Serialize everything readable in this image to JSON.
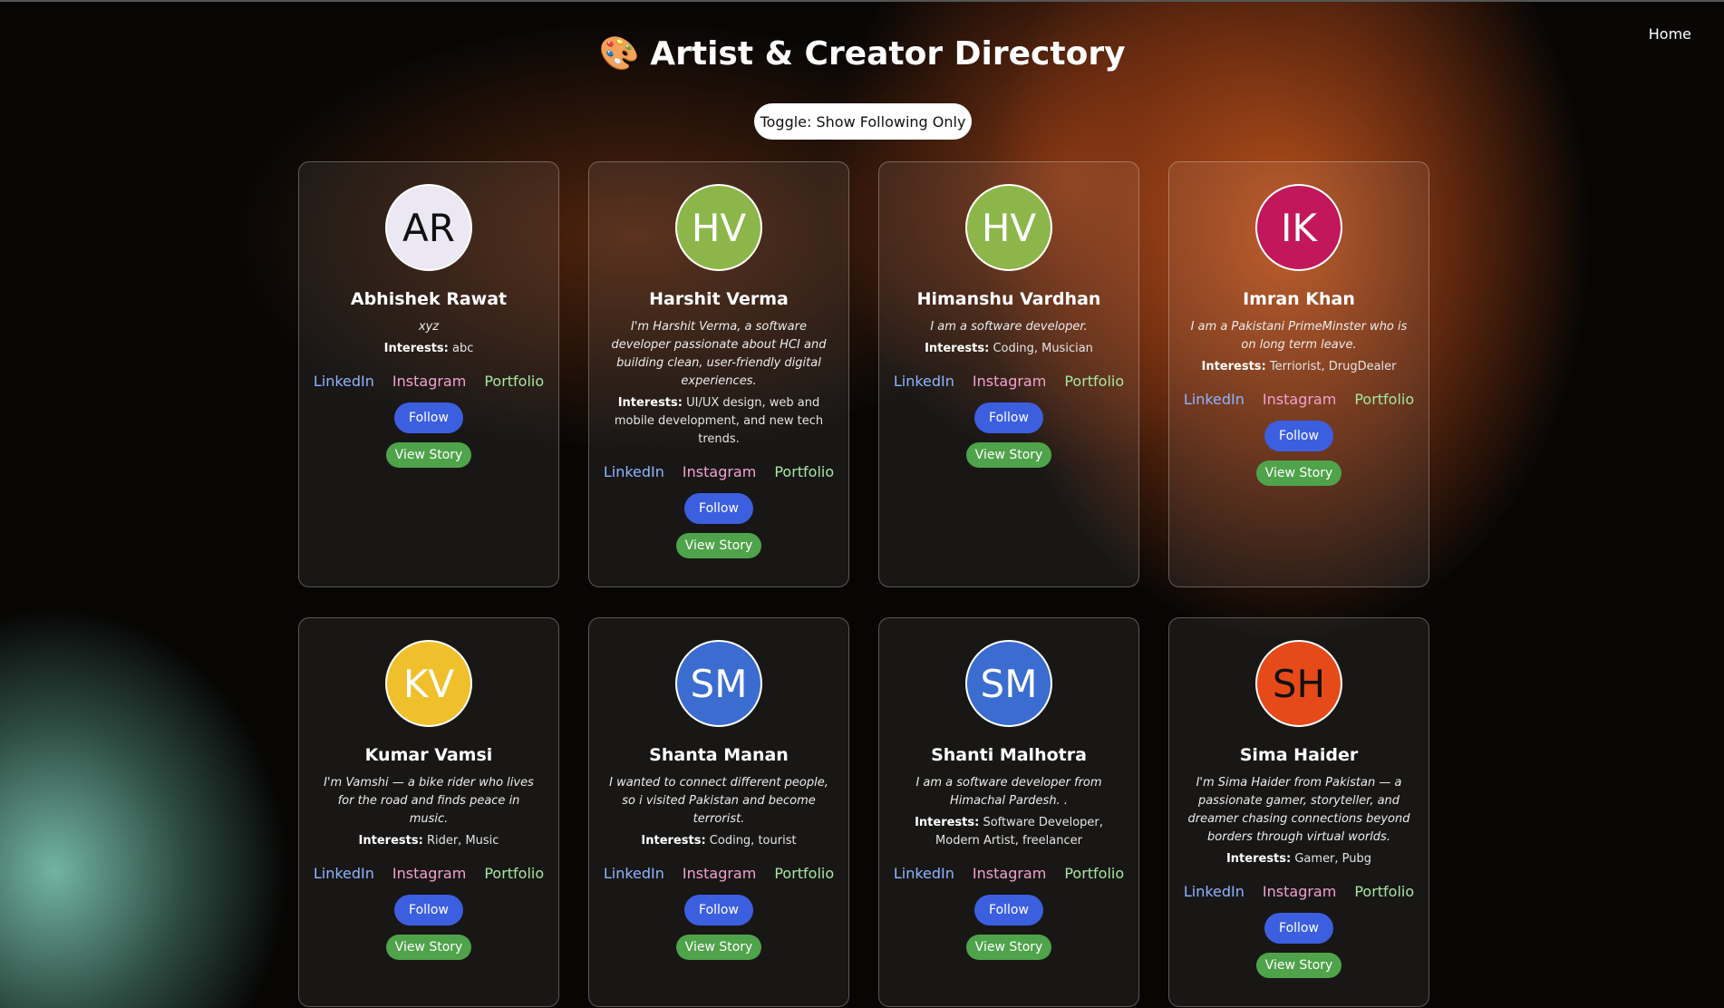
{
  "nav": {
    "home": "Home"
  },
  "header": {
    "icon": "🎨",
    "title": "Artist & Creator Directory",
    "toggle": "Toggle: Show Following Only"
  },
  "labels": {
    "interests": "Interests:",
    "linkedin": "LinkedIn",
    "instagram": "Instagram",
    "portfolio": "Portfolio",
    "follow": "Follow",
    "view_story": "View Story"
  },
  "artists": [
    {
      "initials": "AR",
      "name": "Abhishek Rawat",
      "bio": "xyz",
      "interests": "abc",
      "avatar_bg": "#ece8f3",
      "avatar_fg": "#111111"
    },
    {
      "initials": "HV",
      "name": "Harshit Verma",
      "bio": "I'm Harshit Verma, a software developer passionate about HCI and building clean, user-friendly digital experiences.",
      "interests": "UI/UX design, web and mobile development, and new tech trends.",
      "avatar_bg": "#8db64a",
      "avatar_fg": "#ffffff"
    },
    {
      "initials": "HV",
      "name": "Himanshu Vardhan",
      "bio": "I am a software developer.",
      "interests": "Coding, Musician",
      "avatar_bg": "#8db64a",
      "avatar_fg": "#ffffff"
    },
    {
      "initials": "IK",
      "name": "Imran Khan",
      "bio": "I am a Pakistani PrimeMinster who is on long term leave.",
      "interests": "Terriorist, DrugDealer",
      "avatar_bg": "#c2185b",
      "avatar_fg": "#ffffff"
    },
    {
      "initials": "KV",
      "name": "Kumar Vamsi",
      "bio": "I'm Vamshi — a bike rider who lives for the road and finds peace in music.",
      "interests": "Rider, Music",
      "avatar_bg": "#f0c02c",
      "avatar_fg": "#ffffff"
    },
    {
      "initials": "SM",
      "name": "Shanta Manan",
      "bio": "I wanted to connect different people, so i visited Pakistan and become terrorist.",
      "interests": "Coding, tourist",
      "avatar_bg": "#3b6ccf",
      "avatar_fg": "#ffffff"
    },
    {
      "initials": "SM",
      "name": "Shanti Malhotra",
      "bio": "I am a software developer from Himachal Pardesh. .",
      "interests": "Software Developer, Modern Artist, freelancer",
      "avatar_bg": "#3b6ccf",
      "avatar_fg": "#ffffff"
    },
    {
      "initials": "SH",
      "name": "Sima Haider",
      "bio": "I'm Sima Haider from Pakistan — a passionate gamer, storyteller, and dreamer chasing connections beyond borders through virtual worlds.",
      "interests": "Gamer, Pubg",
      "avatar_bg": "#e64a19",
      "avatar_fg": "#111111"
    }
  ]
}
